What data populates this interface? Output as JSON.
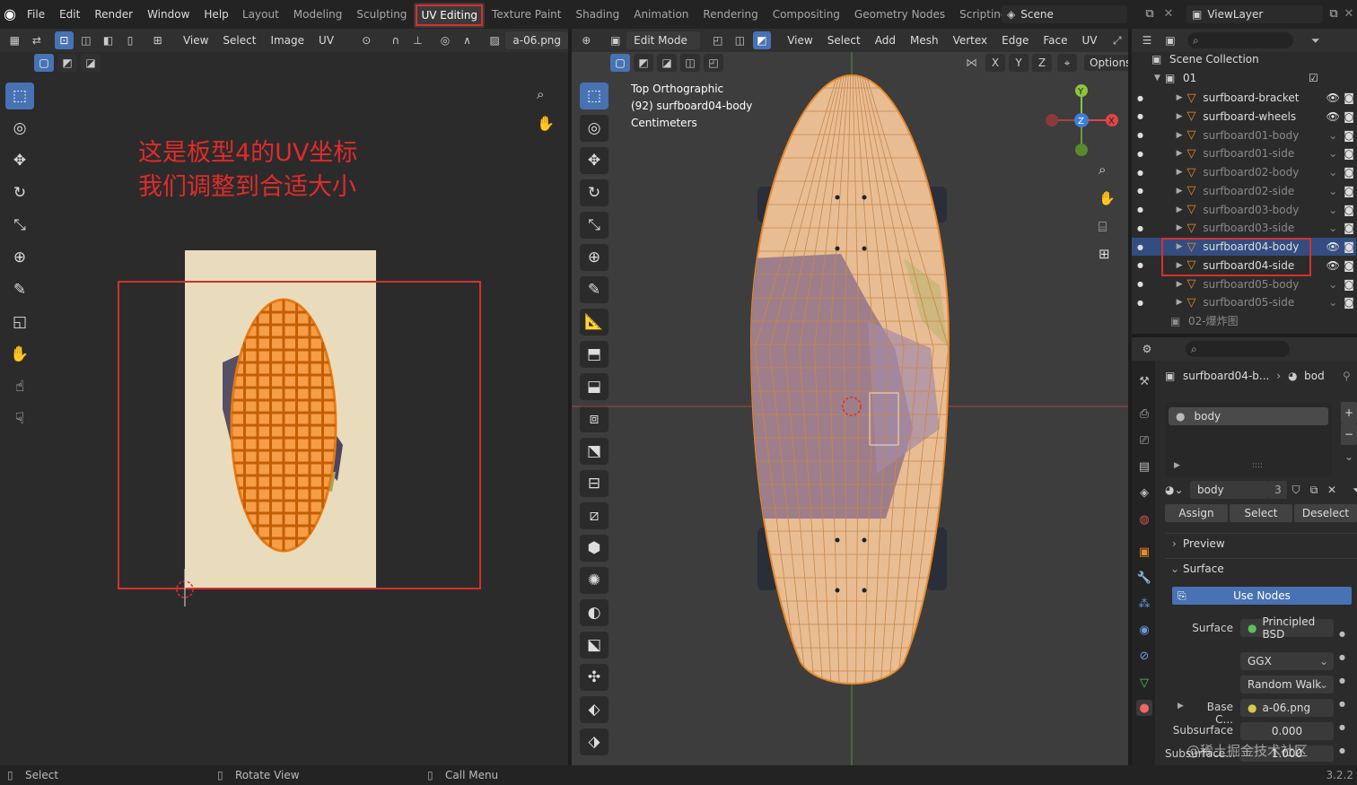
{
  "topbar": {
    "menus": [
      "File",
      "Edit",
      "Render",
      "Window",
      "Help"
    ],
    "workspaces": [
      "Layout",
      "Modeling",
      "Sculpting",
      "UV Editing",
      "Texture Paint",
      "Shading",
      "Animation",
      "Rendering",
      "Compositing",
      "Geometry Nodes",
      "Scripting"
    ],
    "active_workspace": "UV Editing",
    "scene": "Scene",
    "view_layer": "ViewLayer"
  },
  "uv_editor": {
    "header_menus": [
      "View",
      "Select",
      "Image",
      "UV"
    ],
    "image_name": "a-06.png",
    "annotation_line1": "这是板型4的UV坐标",
    "annotation_line2": "我们调整到合适大小"
  },
  "viewport": {
    "mode": "Edit Mode",
    "header_menus": [
      "View",
      "Select",
      "Add",
      "Mesh",
      "Vertex",
      "Edge",
      "Face",
      "UV"
    ],
    "overlay_line1": "Top Orthographic",
    "overlay_line2": "(92) surfboard04-body",
    "overlay_line3": "Centimeters",
    "axes": [
      "X",
      "Y",
      "Z"
    ],
    "options_label": "Options",
    "gizmo_labels": {
      "y": "Y",
      "x": "X",
      "z": "Z"
    }
  },
  "outliner": {
    "title": "Scene Collection",
    "collection": "01",
    "items": [
      {
        "name": "surfboard-bracket",
        "dim": false
      },
      {
        "name": "surfboard-wheels",
        "dim": false
      },
      {
        "name": "surfboard01-body",
        "dim": true
      },
      {
        "name": "surfboard01-side",
        "dim": true
      },
      {
        "name": "surfboard02-body",
        "dim": true
      },
      {
        "name": "surfboard02-side",
        "dim": true
      },
      {
        "name": "surfboard03-body",
        "dim": true
      },
      {
        "name": "surfboard03-side",
        "dim": true
      },
      {
        "name": "surfboard04-body",
        "dim": false,
        "selected": true
      },
      {
        "name": "surfboard04-side",
        "dim": false
      },
      {
        "name": "surfboard05-body",
        "dim": true
      },
      {
        "name": "surfboard05-side",
        "dim": true
      }
    ],
    "collection2": "02-爆炸图"
  },
  "properties": {
    "breadcrumb_object": "surfboard04-b...",
    "breadcrumb_material": "bod",
    "slot_name": "body",
    "material_name": "body",
    "user_count": "3",
    "assign": "Assign",
    "select": "Select",
    "deselect": "Deselect",
    "preview": "Preview",
    "surface_panel": "Surface",
    "use_nodes": "Use Nodes",
    "surface_label": "Surface",
    "surface_value": "Principled BSD",
    "distribution": "GGX",
    "subsurface_method": "Random Walk",
    "base_color_label": "Base C...",
    "base_color_value": "a-06.png",
    "subsurface_label": "Subsurface",
    "subsurface_value": "0.000",
    "subsurface2_label": "Subsurface...",
    "subsurface2_value": "1.000"
  },
  "status": {
    "select": "Select",
    "rotate": "Rotate View",
    "call_menu": "Call Menu",
    "version": "3.2.2",
    "watermark": "@稀土掘金技术社区"
  },
  "colors": {
    "accent_blue": "#4772b3",
    "annotation_red": "#e02b2b",
    "mesh_orange": "#e88b2c"
  }
}
